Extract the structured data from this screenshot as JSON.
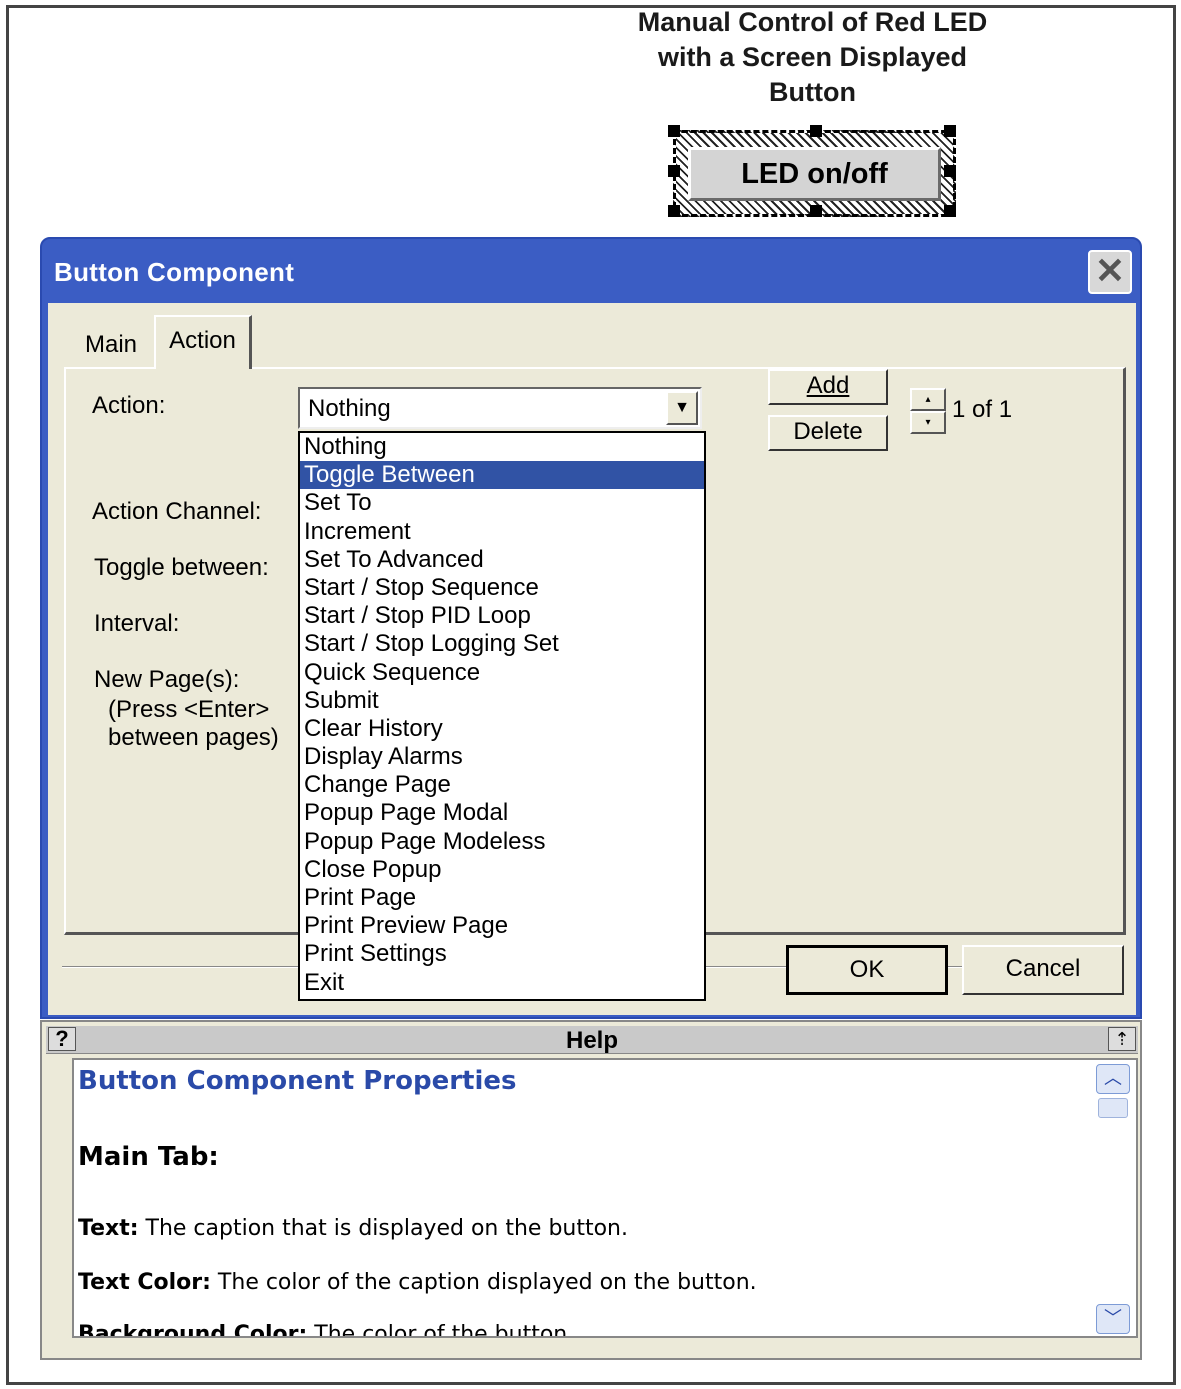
{
  "caption": [
    "Manual Control of Red LED",
    "with a Screen Displayed",
    "Button"
  ],
  "led_button": {
    "label": "LED on/off"
  },
  "dialog": {
    "title": "Button Component",
    "close_glyph": "✕",
    "tabs": [
      {
        "label": "Main"
      },
      {
        "label": "Action"
      }
    ],
    "active_tab": "Action",
    "labels": {
      "action": "Action:",
      "action_channel": "Action Channel:",
      "toggle_between": "Toggle between:",
      "interval": "Interval:",
      "new_pages": "New Page(s):",
      "press_enter": "(Press <Enter>",
      "between_pages": "between pages)"
    },
    "action_select": {
      "value": "Nothing",
      "options": [
        "Nothing",
        "Toggle Between",
        "Set To",
        "Increment",
        "Set To Advanced",
        "Start / Stop Sequence",
        "Start / Stop PID Loop",
        "Start / Stop Logging Set",
        "Quick Sequence",
        "Submit",
        "Clear History",
        "Display Alarms",
        "Change Page",
        "Popup Page Modal",
        "Popup Page Modeless",
        "Close Popup",
        "Print Page",
        "Print Preview Page",
        "Print Settings",
        "Exit"
      ],
      "highlighted": "Toggle Between"
    },
    "add_label": "Add",
    "delete_label": "Delete",
    "counter": "1 of 1",
    "ok_label": "OK",
    "cancel_label": "Cancel"
  },
  "help": {
    "bar_title": "Help",
    "question": "?",
    "heading": "Button Component Properties",
    "subheading": "Main Tab:",
    "lines": [
      {
        "term": "Text:",
        "desc": " The caption that is displayed on the button."
      },
      {
        "term": "Text Color:",
        "desc": " The color of the caption displayed on the button."
      },
      {
        "term": "Background Color:",
        "desc": " The color of the button."
      }
    ]
  },
  "colors": {
    "title_bar": "#3b5dc4",
    "selection": "#3153a5",
    "help_heading": "#2a4aa8",
    "dialog_bg": "#ecead9"
  },
  "icons": [
    "close-icon",
    "dropdown-arrow-icon",
    "spin-up-icon",
    "spin-down-icon",
    "help-icon",
    "pin-icon",
    "scroll-up-icon",
    "scroll-down-icon"
  ]
}
